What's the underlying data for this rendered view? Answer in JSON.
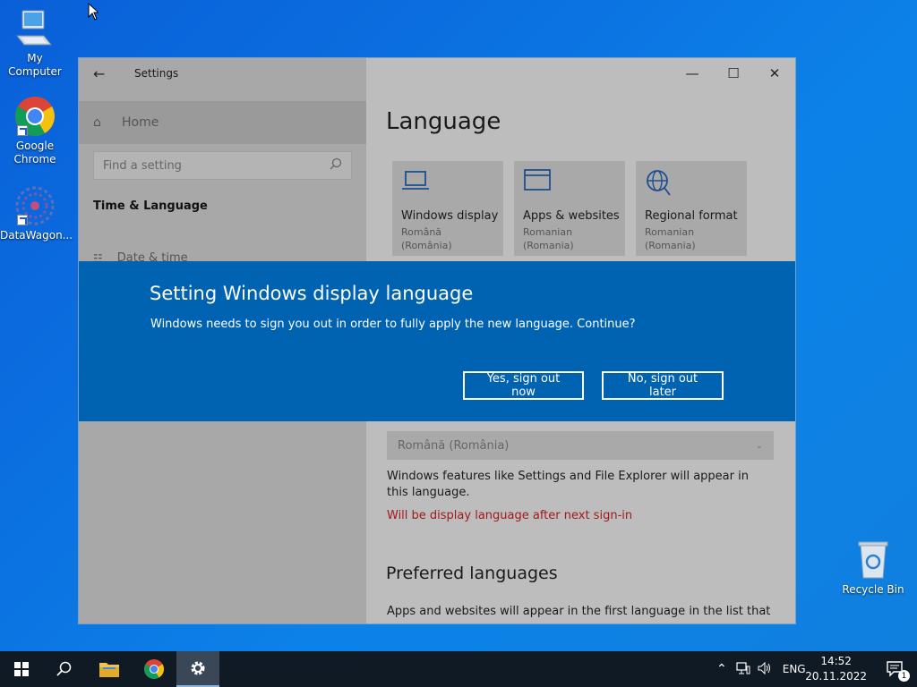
{
  "desktop": {
    "icons": [
      {
        "label": "My Computer",
        "icon": "computer-icon"
      },
      {
        "label": "Google Chrome",
        "icon": "chrome-icon"
      },
      {
        "label": "DataWagon...",
        "icon": "datawagon-icon"
      },
      {
        "label": "Recycle Bin",
        "icon": "recycle-bin-icon"
      }
    ]
  },
  "window": {
    "title": "Settings",
    "sidebar": {
      "home_label": "Home",
      "search_placeholder": "Find a setting",
      "section_title": "Time & Language",
      "items": [
        {
          "label": "Date & time",
          "icon": "calendar-clock-icon"
        }
      ]
    },
    "main": {
      "heading": "Language",
      "tiles": [
        {
          "label": "Windows display",
          "sub": "Română (România)",
          "icon": "laptop-icon"
        },
        {
          "label": "Apps & websites",
          "sub": "Romanian (Romania)",
          "icon": "window-icon"
        },
        {
          "label": "Regional format",
          "sub": "Romanian (Romania)",
          "icon": "globe-icon"
        }
      ],
      "display_language_value": "Română (România)",
      "display_language_desc": "Windows features like Settings and File Explorer will appear in this language.",
      "display_language_warning": "Will be display language after next sign-in",
      "preferred_heading": "Preferred languages",
      "preferred_desc": "Apps and websites will appear in the first language in the list that"
    }
  },
  "dialog": {
    "title": "Setting Windows display language",
    "message": "Windows needs to sign you out in order to fully apply the new language. Continue?",
    "yes_label": "Yes, sign out now",
    "no_label": "No, sign out later",
    "background_color": "#0063b1"
  },
  "taskbar": {
    "language": "ENG",
    "time": "14:52",
    "date": "20.11.2022",
    "notification_count": "1"
  }
}
